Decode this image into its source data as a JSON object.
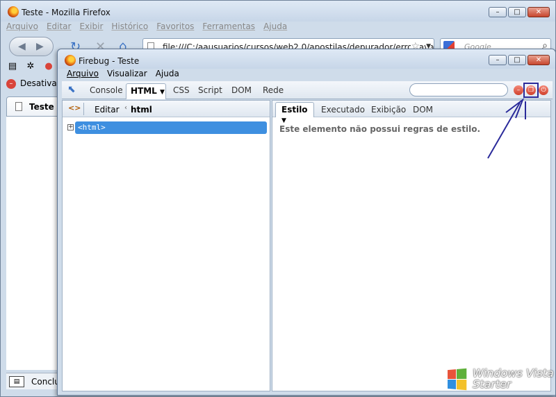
{
  "firefox": {
    "title": "Teste - Mozilla Firefox",
    "menu": [
      "Arquivo",
      "Editar",
      "Exibir",
      "Histórico",
      "Favoritos",
      "Ferramentas",
      "Ajuda"
    ],
    "url": "file:///C:/aausuarios/cursos/web2.0/apostilas/depurador/erro_javascript.html",
    "search_placeholder": "Google",
    "firebug_bar_label": "Desativar",
    "tab_label": "Teste",
    "status_text": "Concluído"
  },
  "firebug": {
    "title": "Firebug - Teste",
    "menu": [
      "Arquivo",
      "Visualizar",
      "Ajuda"
    ],
    "tabs": [
      "Console",
      "HTML",
      "CSS",
      "Script",
      "DOM",
      "Rede"
    ],
    "active_tab": "HTML",
    "left_panel": {
      "edit_label": "Editar",
      "breadcrumb": "html",
      "node_label": "<html>"
    },
    "side_tabs": [
      "Estilo",
      "Executado",
      "Exibição",
      "DOM"
    ],
    "active_side_tab": "Estilo",
    "style_message": "Este elemento não possui regras de estilo."
  },
  "branding": {
    "line1": "Windows Vista",
    "line2": "Starter"
  }
}
